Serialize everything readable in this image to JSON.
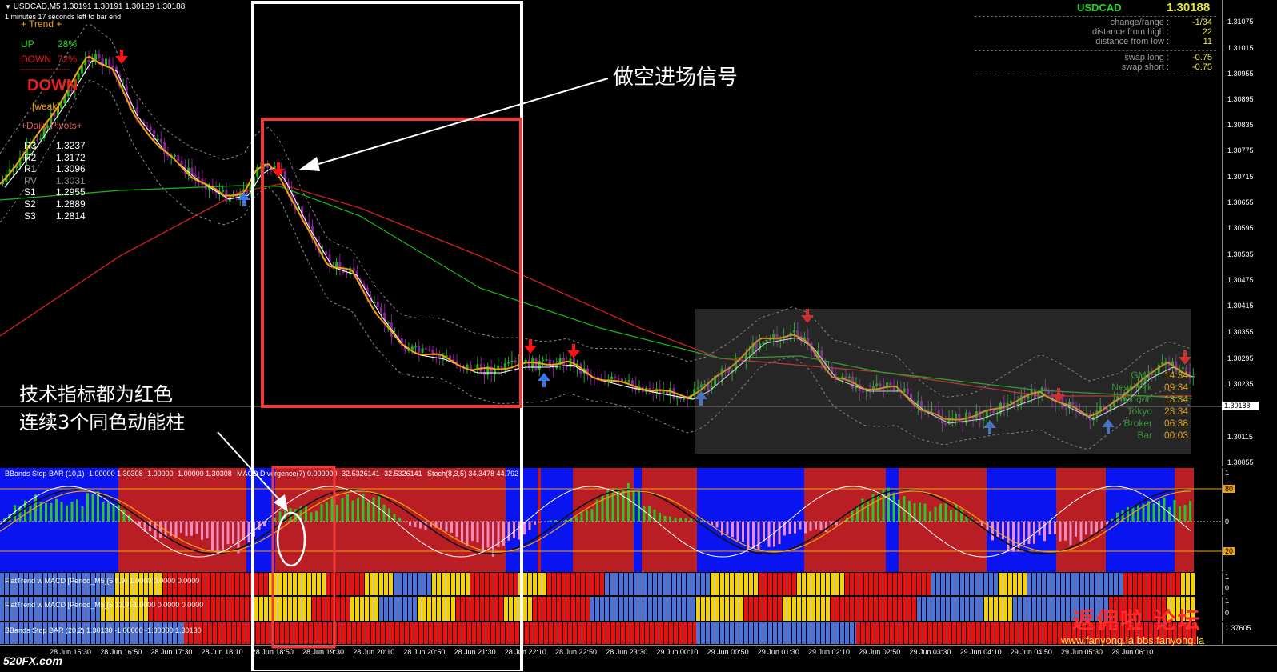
{
  "window": {
    "symbol_header": "USDCAD,M5  1.30191 1.30191 1.30129 1.30188",
    "timer": "1 minutes 17 seconds left to bar end",
    "header_arrow": "▼"
  },
  "trend_panel": {
    "title": "+   Trend   +",
    "up_label": "UP",
    "up_value": "28%",
    "down_label": "DOWN",
    "down_value": "72%",
    "separator": "-----------------------",
    "signal": "DOWN",
    "strength": "[weak]",
    "pivots_title": "+Daily Pivots+",
    "pivots": [
      {
        "name": "R3",
        "value": "1.3237"
      },
      {
        "name": "R2",
        "value": "1.3172"
      },
      {
        "name": "R1",
        "value": "1.3096"
      },
      {
        "name": "PV",
        "value": "1.3031"
      },
      {
        "name": "S1",
        "value": "1.2955"
      },
      {
        "name": "S2",
        "value": "1.2889"
      },
      {
        "name": "S3",
        "value": "1.2814"
      }
    ]
  },
  "info_panel": {
    "symbol": "USDCAD",
    "price": "1.30188",
    "rows": [
      {
        "label": "change/range :",
        "value": "-1/34"
      },
      {
        "label": "distance from high :",
        "value": "22"
      },
      {
        "label": "distance from low :",
        "value": "11"
      },
      {
        "label": "swap long :",
        "value": "-0.75"
      },
      {
        "label": "swap short :",
        "value": "-0.75"
      }
    ]
  },
  "sessions": [
    {
      "name": "GMT",
      "time": "14:34"
    },
    {
      "name": "New York",
      "time": "09:34"
    },
    {
      "name": "London",
      "time": "13:34"
    },
    {
      "name": "Tokyo",
      "time": "23:34"
    },
    {
      "name": "Broker",
      "time": "06:38"
    },
    {
      "name": "Bar",
      "time": "00:03"
    }
  ],
  "price_axis": [
    "1.31075",
    "1.31015",
    "1.30955",
    "1.30895",
    "1.30835",
    "1.30775",
    "1.30715",
    "1.30655",
    "1.30595",
    "1.30535",
    "1.30475",
    "1.30415",
    "1.30355",
    "1.30295",
    "1.30235",
    "1.30188",
    "1.30115",
    "1.30055"
  ],
  "current_price_label": "1.30188",
  "indicators": {
    "bbands_bar": "BBands Stop BAR (10,1) -1.00000 1.30308 -1.00000 -1.00000 1.30308",
    "divergence": "MACD Divergence(7) 0.000000 -32.5326141 -32.5326141",
    "stoch": "Stoch(8,3,5) 34.3478 44.792",
    "flattrend1": "FlatTrend w MACD [Period_M5](5,8,9) 1.0000 0.0000 0.0000",
    "flattrend2": "FlatTrend w MACD [Period_M5](5,13,9) 1.0000 0.0000 0.0000",
    "bbands_bar2": "BBands Stop BAR (20,2) 1.30130 -1.00000 -1.00000 1.30130",
    "osc_levels": [
      "80",
      "0",
      "20"
    ],
    "osc_top": "1",
    "ft_levels": [
      "1",
      "0"
    ],
    "last_axis": "1.37605"
  },
  "time_axis": [
    "28 Jun 15:30",
    "28 Jun 16:50",
    "28 Jun 17:30",
    "28 Jun 18:10",
    "28 Jun 18:50",
    "28 Jun 19:30",
    "28 Jun 20:10",
    "28 Jun 20:50",
    "28 Jun 21:30",
    "28 Jun 22:10",
    "28 Jun 22:50",
    "28 Jun 23:30",
    "29 Jun 00:10",
    "29 Jun 00:50",
    "29 Jun 01:30",
    "29 Jun 02:10",
    "29 Jun 02:50",
    "29 Jun 03:30",
    "29 Jun 04:10",
    "29 Jun 04:50",
    "29 Jun 05:30",
    "29 Jun 06:10"
  ],
  "annotations": {
    "short_signal": "做空进场信号",
    "line1": "技术指标都为红色",
    "line2": "连续3个同色动能柱"
  },
  "watermark": {
    "left": "520FX.com",
    "title": "返佣啦 论坛",
    "url": "www.fanyong.la  bbs.fanyong.la"
  },
  "colors": {
    "bull": "#1db31d",
    "bear": "#8a1f9a",
    "ma_orange": "#f2a20b",
    "ma_red": "#d42020",
    "ma_green": "#17b317",
    "blue_zone": "#0a14f0",
    "red_zone": "#b81e24",
    "yellow": "#f4d20a",
    "annotation_red": "#ef3a3a"
  }
}
